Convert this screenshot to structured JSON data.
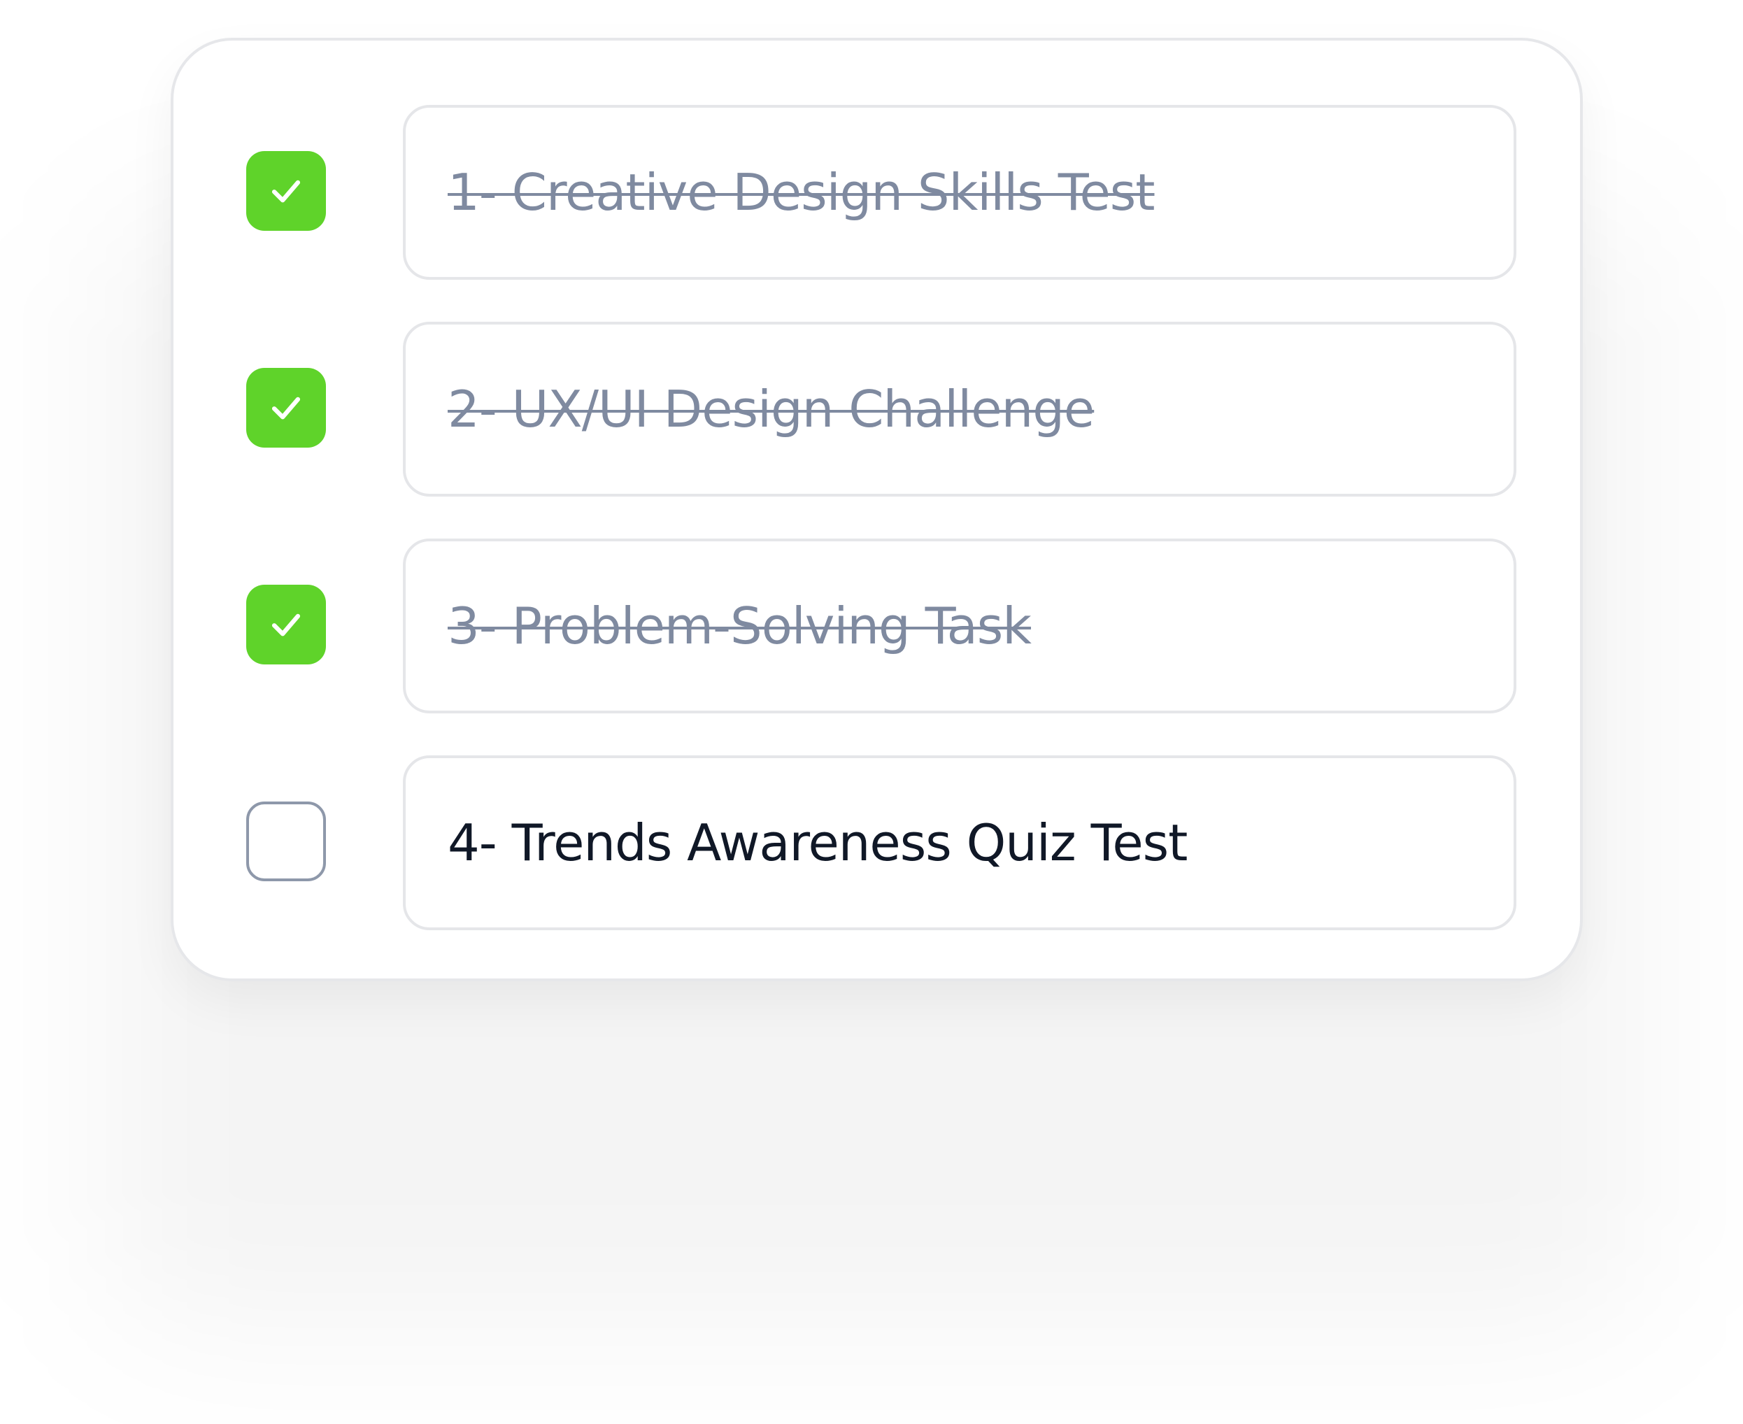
{
  "colors": {
    "accent": "#5fd32a",
    "done_text": "#7f8aa0",
    "todo_text": "#101827",
    "border": "#e5e6e9",
    "unchecked_border": "#8e98aa"
  },
  "tasks": [
    {
      "label": "1- Creative Design Skills Test",
      "completed": true,
      "icon": "check-icon"
    },
    {
      "label": "2- UX/UI Design Challenge",
      "completed": true,
      "icon": "check-icon"
    },
    {
      "label": "3- Problem-Solving Task",
      "completed": true,
      "icon": "check-icon"
    },
    {
      "label": "4- Trends Awareness Quiz Test",
      "completed": false,
      "icon": ""
    }
  ]
}
